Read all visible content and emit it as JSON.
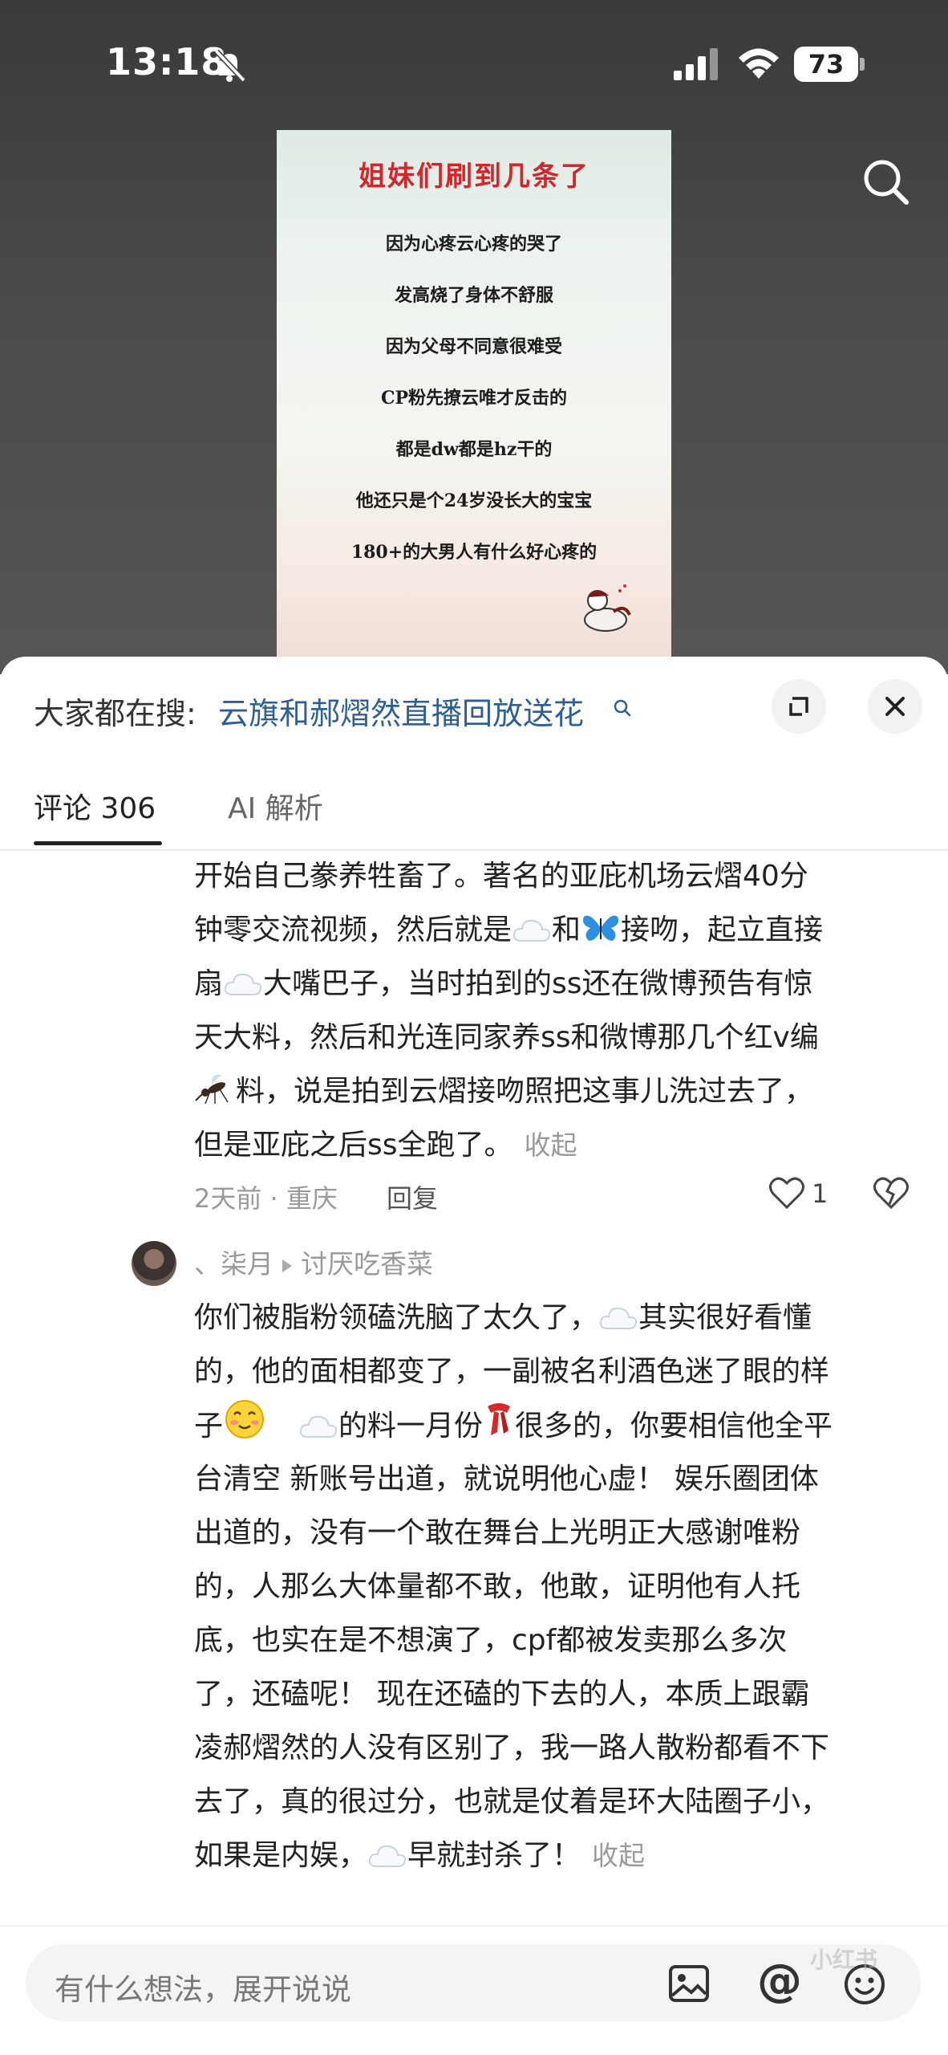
{
  "status_bar": {
    "time": "13:18",
    "battery": "73"
  },
  "video": {
    "title": "姐妹们刷到几条了",
    "lines": [
      "因为心疼云心疼的哭了",
      "发高烧了身体不舒服",
      "因为父母不同意很难受",
      "CP粉先撩云唯才反击的",
      "都是dw都是hz干的",
      "他还只是个24岁没长大的宝宝",
      "180+的大男人有什么好心疼的"
    ]
  },
  "sheet": {
    "search_prefix": "大家都在搜:",
    "search_topic": "云旗和郝熠然直播回放送花",
    "tabs": {
      "comments": "评论 306",
      "ai": "AI 解析"
    }
  },
  "comment1": {
    "lines": [
      "开始自己豢养牲畜了。著名的亚庇机场云熠40分",
      [
        "钟零交流视频，然后就是",
        "和",
        "接吻，起立直接"
      ],
      [
        "扇",
        "大嘴巴子，当时拍到的ss还在微博预告有惊"
      ],
      "天大料，然后和光连同家养ss和微博那几个红v编",
      "料，说是拍到云熠接吻照把这事儿洗过去了，",
      "但是亚庇之后ss全跑了。"
    ],
    "collapse": "收起",
    "time_location": "2天前 · 重庆",
    "reply": "回复",
    "like_count": "1"
  },
  "comment2": {
    "author": "、柒月",
    "reply_to": "讨厌吃香菜",
    "lines": [
      "你们被脂粉领磕洗脑了太久了，",
      "其实很好看懂",
      "的，他的面相都变了，一副被名利酒色迷了眼的样",
      "子",
      "的料一月份",
      "很多的，你要相信他全平",
      "台清空 新账号出道，就说明他心虚！ 娱乐圈团体",
      "出道的，没有一个敢在舞台上光明正大感谢唯粉",
      "的，人那么大体量都不敢，他敢，证明他有人托",
      "底，也实在是不想演了，cpf都被发卖那么多次",
      "了，还磕呢！ 现在还磕的下去的人，本质上跟霸",
      "凌郝熠然的人没有区别了，我一路人散粉都看不下",
      "去了，真的很过分，也就是仗着是环大陆圈子小，",
      "如果是内娱，",
      "早就封杀了！"
    ],
    "collapse": "收起"
  },
  "input": {
    "placeholder": "有什么想法，展开说说"
  },
  "watermark": "小红书",
  "colors": {
    "link": "#2d5f93",
    "title_red": "#d4262a"
  }
}
